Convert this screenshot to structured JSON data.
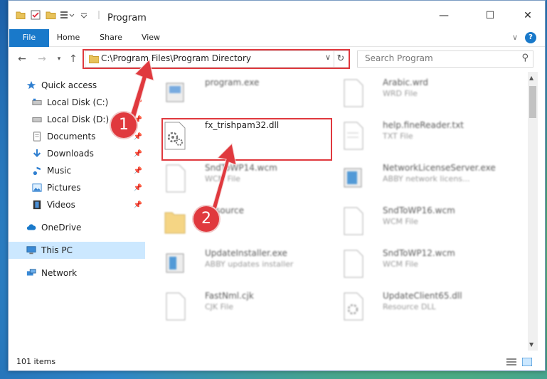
{
  "window": {
    "title": "Program",
    "minimize": "—",
    "maximize": "☐",
    "close": "✕"
  },
  "ribbon": {
    "tabs": [
      "File",
      "Home",
      "Share",
      "View"
    ],
    "collapse": "∨",
    "help": "?"
  },
  "address": {
    "path": "C:\\Program Files\\Program Directory"
  },
  "search": {
    "placeholder": "Search Program"
  },
  "sidebar": {
    "items": [
      {
        "label": "Quick access",
        "icon": "star-icon"
      },
      {
        "label": "Local Disk (C:)",
        "icon": "drive-icon"
      },
      {
        "label": "Local Disk (D:)",
        "icon": "drive-icon"
      },
      {
        "label": "Documents",
        "icon": "documents-icon"
      },
      {
        "label": "Downloads",
        "icon": "downloads-icon"
      },
      {
        "label": "Music",
        "icon": "music-icon"
      },
      {
        "label": "Pictures",
        "icon": "pictures-icon"
      },
      {
        "label": "Videos",
        "icon": "videos-icon"
      },
      {
        "label": "OneDrive",
        "icon": "cloud-icon"
      },
      {
        "label": "This PC",
        "icon": "computer-icon"
      },
      {
        "label": "Network",
        "icon": "network-icon"
      }
    ]
  },
  "files": {
    "left": [
      {
        "name": "program.exe",
        "type": ""
      },
      {
        "name": "fx_trishpam32.dll",
        "type": ""
      },
      {
        "name": "SndToWP14.wcm",
        "type": "WCM File"
      },
      {
        "name": "Resource",
        "type": ""
      },
      {
        "name": "UpdateInstaller.exe",
        "type": "ABBY updates installer"
      },
      {
        "name": "FastNml.cjk",
        "type": "CJK File"
      }
    ],
    "right": [
      {
        "name": "Arabic.wrd",
        "type": "WRD File"
      },
      {
        "name": "help.fineReader.txt",
        "type": "TXT File"
      },
      {
        "name": "NetworkLicenseServer.exe",
        "type": "ABBY network licens..."
      },
      {
        "name": "SndToWP16.wcm",
        "type": "WCM File"
      },
      {
        "name": "SndToWP12.wcm",
        "type": "WCM File"
      },
      {
        "name": "UpdateClient65.dll",
        "type": "Resource DLL"
      }
    ]
  },
  "status": {
    "count": "101 items"
  },
  "annotations": {
    "step1": "1",
    "step2": "2"
  },
  "colors": {
    "accent": "#1979ca",
    "highlight": "#e0393e",
    "selected": "#cce8ff"
  }
}
